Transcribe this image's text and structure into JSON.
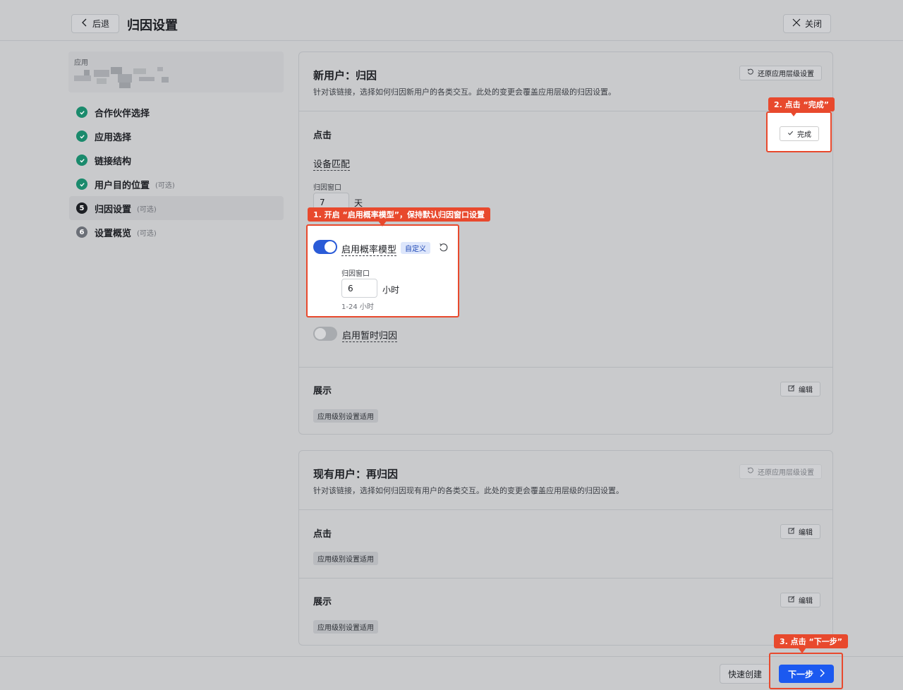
{
  "header": {
    "back_label": "后退",
    "title": "归因设置",
    "close_label": "关闭"
  },
  "sidebar": {
    "app_label": "应用",
    "steps": [
      {
        "label": "合作伙伴选择",
        "optional": "",
        "state": "done"
      },
      {
        "label": "应用选择",
        "optional": "",
        "state": "done"
      },
      {
        "label": "链接结构",
        "optional": "",
        "state": "done"
      },
      {
        "label": "用户目的位置",
        "optional": "(可选)",
        "state": "done"
      },
      {
        "label": "归因设置",
        "optional": "(可选)",
        "state": "current",
        "number": "5"
      },
      {
        "label": "设置概览",
        "optional": "(可选)",
        "state": "todo",
        "number": "6"
      }
    ]
  },
  "card_new": {
    "title": "新用户：归因",
    "description": "针对该链接，选择如何归因新用户的各类交互。此处的变更会覆盖应用层级的归因设置。",
    "restore_label": "还原应用层级设置",
    "click_section": "点击",
    "done_label": "完成",
    "device_match": "设备匹配",
    "window_label": "归因窗口",
    "window_value": "7",
    "window_unit": "天",
    "prob_model_label": "启用概率模型",
    "prob_model_badge": "自定义",
    "prob_window_label": "归因窗口",
    "prob_window_value": "6",
    "prob_window_unit": "小时",
    "prob_window_hint": "1-24 小时",
    "temp_attr_label": "启用暂时归因",
    "impression_section": "展示",
    "edit_label": "编辑",
    "app_level_tag": "应用级别设置适用"
  },
  "card_existing": {
    "title": "现有用户：再归因",
    "description": "针对该链接，选择如何归因现有用户的各类交互。此处的变更会覆盖应用层级的归因设置。",
    "restore_label": "还原应用层级设置",
    "click_section": "点击",
    "impression_section": "展示",
    "edit_label": "编辑",
    "app_level_tag": "应用级别设置适用"
  },
  "callouts": {
    "step1": "1. 开启 “启用概率模型”，保持默认归因窗口设置",
    "step2": "2. 点击 “完成”",
    "step3": "3. 点击 “下一步”"
  },
  "footer": {
    "quick_create_label": "快速创建",
    "next_label": "下一步"
  },
  "colors": {
    "accent": "#1b59f0",
    "toggle_on": "#2a5bd7",
    "done_green": "#1a8a6c",
    "callout_red": "#e8492d"
  }
}
